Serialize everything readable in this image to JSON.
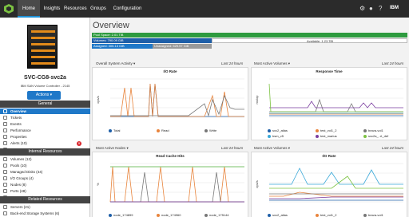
{
  "nav": {
    "tabs": [
      "Home",
      "Insights",
      "Resources",
      "Groups",
      "Configuration"
    ]
  },
  "sidebar": {
    "system_name": "SVC-CG8-svc2a",
    "system_desc": "IBM SAN Volume Controller - 2145",
    "actions_label": "Actions",
    "general_header": "General",
    "general_items": [
      "Overview",
      "Tickets",
      "Events",
      "Performance",
      "Properties",
      "Alerts (10)",
      "Copy Data"
    ],
    "internal_header": "Internal Resources",
    "internal_items": [
      "Volumes (12)",
      "Pools (10)",
      "Managed Disks (44)",
      "I/O Groups (4)",
      "Nodes (8)",
      "Ports (48)",
      "Host Connections (35)"
    ],
    "related_header": "Related Resources",
    "related_items": [
      "Servers (21)",
      "Back-end Storage Systems (6)"
    ]
  },
  "main": {
    "title": "Overview",
    "capacity": {
      "pool": "Pool Space: 2.01 TiB",
      "volumes": "Volumes: 790.09 GiB",
      "available": "Available: 1.23 TiB",
      "assigned": "Assigned: 305.13 GiB",
      "unassigned": "Unassigned: 529.97 GiB"
    },
    "panels": [
      {
        "head": "Overall System Activity",
        "range": "Last 24 hours",
        "title": "I/O Rate",
        "ylabel": "ops/s"
      },
      {
        "head": "Most Active Volumes",
        "range": "Last 24 hours",
        "title": "Response Time",
        "ylabel": "ms/op"
      },
      {
        "head": "Most Active Nodes",
        "range": "Last 24 hours",
        "title": "Read Cache Hits",
        "ylabel": "%"
      },
      {
        "head": "Most Active Volumes",
        "range": "Last 24 hours",
        "title": "I/O Rate",
        "ylabel": "ops/s"
      }
    ]
  },
  "chart_data": [
    {
      "type": "line",
      "title": "I/O Rate",
      "ylabel": "ops/s",
      "series": [
        {
          "name": "Total",
          "color": "#1f5fa8"
        },
        {
          "name": "Read",
          "color": "#e8843c"
        },
        {
          "name": "Write",
          "color": "#777777"
        }
      ]
    },
    {
      "type": "line",
      "title": "Response Time",
      "ylabel": "ms/op",
      "series": [
        {
          "name": "svc2_atlas",
          "color": "#1f5fa8"
        },
        {
          "name": "test_vol1_2",
          "color": "#e8843c"
        },
        {
          "name": "brava-vol1",
          "color": "#777777"
        },
        {
          "name": "bsm_v5",
          "color": "#3aa8d8"
        },
        {
          "name": "test_marius",
          "color": "#7b3fa0"
        },
        {
          "name": "svc2a_..rt_def",
          "color": "#7cc242"
        }
      ]
    },
    {
      "type": "line",
      "title": "Read Cache Hits",
      "ylabel": "%",
      "series": [
        {
          "name": "node_174899",
          "color": "#1f5fa8"
        },
        {
          "name": "node_174960",
          "color": "#e8843c"
        },
        {
          "name": "node_175144",
          "color": "#777777"
        },
        {
          "name": "node_174941",
          "color": "#3aa8d8"
        },
        {
          "name": "node_174942",
          "color": "#7b3fa0"
        },
        {
          "name": "node_175145",
          "color": "#7cc242"
        }
      ]
    },
    {
      "type": "line",
      "title": "I/O Rate",
      "ylabel": "ops/s",
      "series": [
        {
          "name": "svc2_atlas",
          "color": "#1f5fa8"
        },
        {
          "name": "test_vol1_2",
          "color": "#e8843c"
        },
        {
          "name": "brava-vol1",
          "color": "#777777"
        },
        {
          "name": "bsm_v5",
          "color": "#3aa8d8"
        },
        {
          "name": "test_marius",
          "color": "#7b3fa0"
        },
        {
          "name": "svc2a_..rt_def",
          "color": "#7cc242"
        }
      ]
    }
  ]
}
